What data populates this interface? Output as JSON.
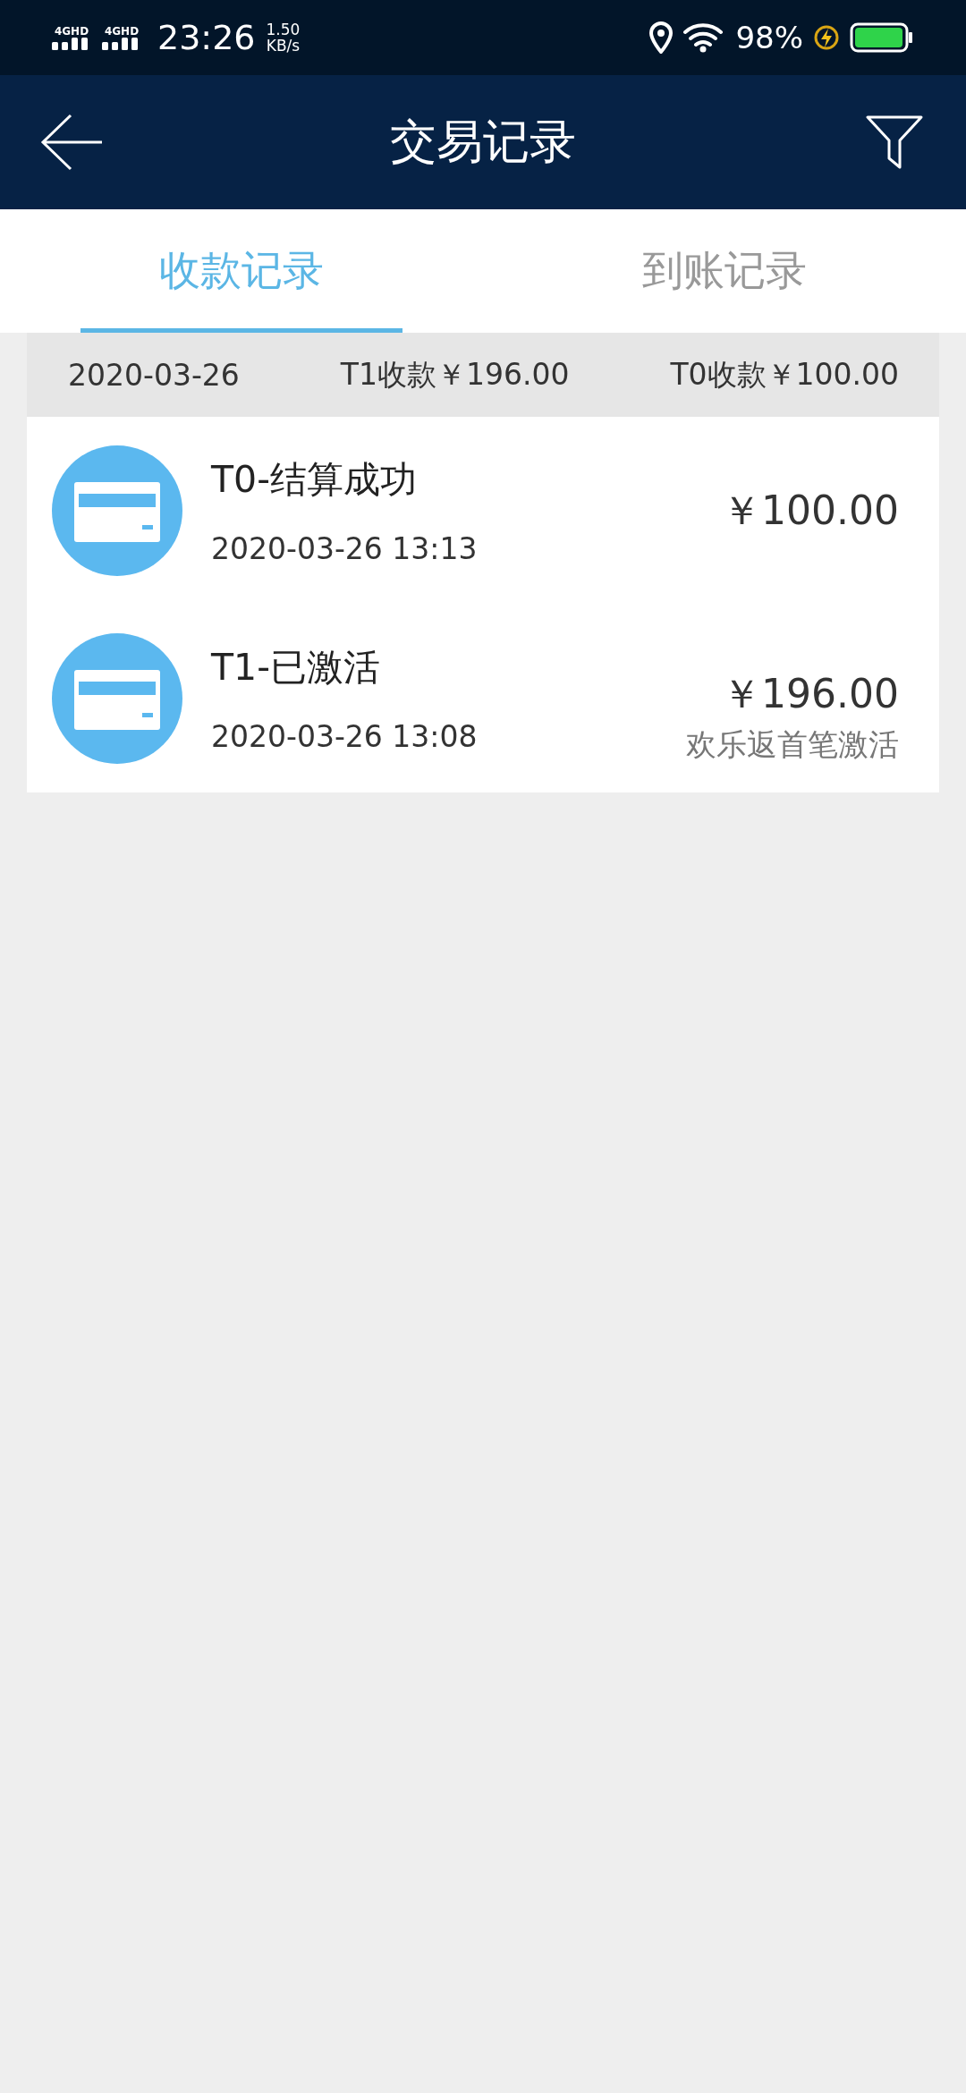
{
  "status_bar": {
    "networks": [
      "4GHD",
      "4GHD"
    ],
    "time": "23:26",
    "speed": "1.50",
    "speed_unit": "KB/s",
    "battery": "98%",
    "charging": true
  },
  "header": {
    "title": "交易记录"
  },
  "tabs": [
    {
      "label": "收款记录",
      "selected": true
    },
    {
      "label": "到账记录",
      "selected": false
    }
  ],
  "summary": {
    "date": "2020-03-26",
    "t1_total": "T1收款￥196.00",
    "t0_total": "T0收款￥100.00"
  },
  "transactions": [
    {
      "title": "T0-结算成功",
      "time": "2020-03-26 13:13",
      "amount": "￥100.00"
    },
    {
      "title": "T1-已激活",
      "time": "2020-03-26 13:08",
      "amount": "￥196.00",
      "note": "欢乐返首笔激活"
    }
  ]
}
